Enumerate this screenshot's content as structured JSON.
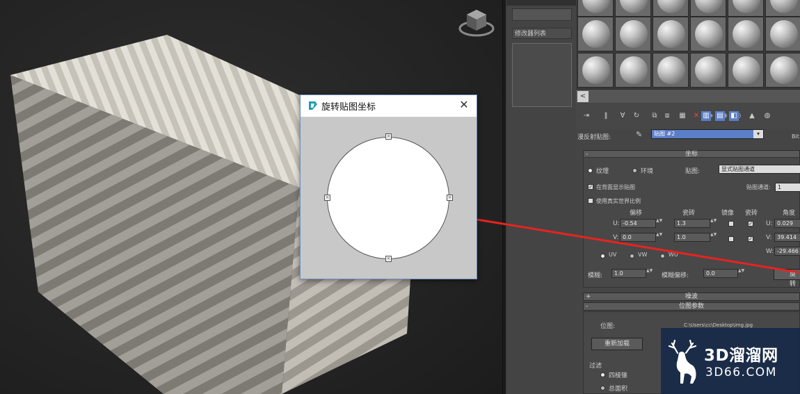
{
  "dialog": {
    "title": "旋转贴图坐标",
    "close_glyph": "✕",
    "handle_glyph": "×"
  },
  "modifier_panel": {
    "list_label": "修改器列表"
  },
  "material_editor": {
    "scroll_left_glyph": "<",
    "map_label": "漫反射贴图:",
    "map_name": "贴图 #2",
    "dropdown_glyph": "▾",
    "side_label": "Bit",
    "coords": {
      "section_title": "坐标",
      "section_toggle": "-",
      "texture_label": "纹理",
      "environ_label": "环境",
      "mapping_label": "贴图:",
      "mapping_value": "显式贴图通道",
      "show_on_back_label": "在背面显示贴图",
      "map_channel_label": "贴图通道:",
      "map_channel_value": "1",
      "real_world_label": "使用真实世界比例",
      "offset_label": "偏移",
      "tiling_label": "瓷砖",
      "mirror_label": "镜像",
      "tile_label": "瓷砖",
      "angle_label": "角度",
      "u_label": "U:",
      "v_label": "V:",
      "w_label": "W:",
      "u_offset": "-0.54",
      "v_offset": "0.0",
      "u_tiling": "1.3",
      "v_tiling": "1.0",
      "u_angle": "0.029",
      "v_angle": "39.414",
      "w_angle": "-29.466",
      "uv_label": "UV",
      "vw_label": "VW",
      "wu_label": "WU",
      "blur_label": "模糊:",
      "blur_value": "1.0",
      "blur_offset_label": "模糊偏移:",
      "blur_offset_value": "0.0",
      "rotate_label": "旋转"
    },
    "noise": {
      "section_title": "噪波",
      "section_toggle": "+"
    },
    "bitmap_params": {
      "section_title": "位图参数",
      "section_toggle": "-",
      "bitmap_label": "位图:",
      "bitmap_path": "C:\\Users\\cc\\Desktop\\img.jpg",
      "reload_label": "重新加载",
      "filter_label": "过滤",
      "filter_pyramid": "四棱锥",
      "filter_summed": "总面积"
    }
  },
  "watermark": {
    "brand": "3D溜溜网",
    "url": "3D66.COM"
  },
  "colors": {
    "accent_blue": "#5b7ec8",
    "annotation_red": "#e8231f",
    "watermark_bg": "#142848"
  }
}
